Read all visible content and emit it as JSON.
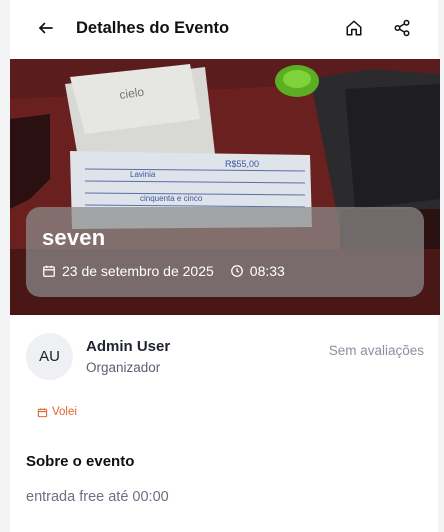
{
  "header": {
    "title": "Detalhes do Evento",
    "back_icon": "arrow-left-icon",
    "home_icon": "home-icon",
    "share_icon": "share-icon"
  },
  "event": {
    "name": "seven",
    "date": "23 de setembro de 2025",
    "time": "08:33"
  },
  "organizer": {
    "initials": "AU",
    "name": "Admin User",
    "role": "Organizador",
    "rating_text": "Sem avaliações"
  },
  "category": {
    "label": "Volei",
    "color": "#e2662e"
  },
  "about": {
    "title": "Sobre o evento",
    "description": "entrada free até 00:00"
  }
}
